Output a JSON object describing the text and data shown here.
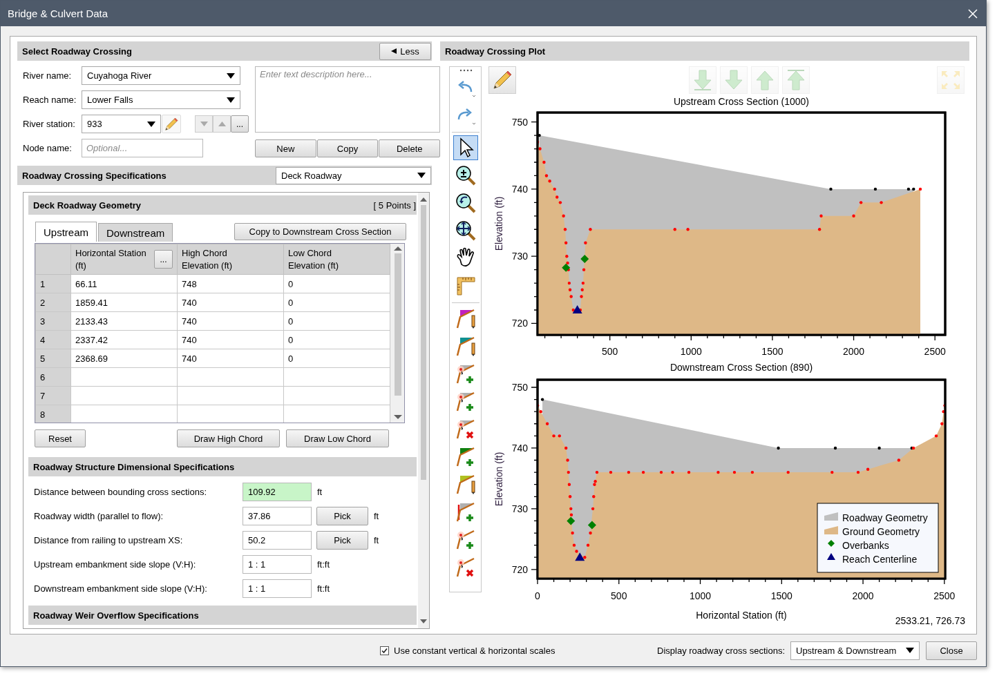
{
  "window": {
    "title": "Bridge & Culvert Data"
  },
  "select_section": {
    "title": "Select Roadway Crossing",
    "less_button": "Less",
    "river_name": {
      "label": "River name:",
      "value": "Cuyahoga River"
    },
    "reach_name": {
      "label": "Reach name:",
      "value": "Lower Falls"
    },
    "river_station": {
      "label": "River station:",
      "value": "933",
      "more_button": "..."
    },
    "node_name": {
      "label": "Node name:",
      "placeholder": "Optional..."
    },
    "description": {
      "placeholder": "Enter text description here..."
    },
    "buttons": [
      "New",
      "Copy",
      "Delete"
    ]
  },
  "specs": {
    "title": "Roadway Crossing Specifications",
    "type": "Deck Roadway"
  },
  "geometry": {
    "title": "Deck Roadway Geometry",
    "count": "[ 5 Points ]",
    "tabs": [
      {
        "label": "Upstream",
        "selected": true
      },
      {
        "label": "Downstream",
        "selected": false
      }
    ],
    "copy_button": "Copy to Downstream Cross Section",
    "columns": [
      "Horizontal Station (ft)",
      "High Chord Elevation (ft)",
      "Low Chord Elevation (ft)"
    ],
    "column_button": "...",
    "rows": [
      {
        "index": "1",
        "cells": [
          "66.11",
          "748",
          "0"
        ]
      },
      {
        "index": "2",
        "cells": [
          "1859.41",
          "740",
          "0"
        ]
      },
      {
        "index": "3",
        "cells": [
          "2133.43",
          "740",
          "0"
        ]
      },
      {
        "index": "4",
        "cells": [
          "2337.42",
          "740",
          "0"
        ]
      },
      {
        "index": "5",
        "cells": [
          "2368.69",
          "740",
          "0"
        ]
      },
      {
        "index": "6"
      },
      {
        "index": "7"
      },
      {
        "index": "8"
      }
    ],
    "reset_button": "Reset",
    "draw_buttons": [
      "Draw High Chord",
      "Draw Low Chord"
    ]
  },
  "dimensions": {
    "title": "Roadway Structure Dimensional Specifications",
    "fields": [
      {
        "label": "Distance between bounding cross sections:",
        "value": "109.92",
        "unit": "ft",
        "highlighted": true
      },
      {
        "label": "Roadway width (parallel to flow):",
        "value": "37.86",
        "pick": "Pick",
        "unit": "ft",
        "highlighted": false
      },
      {
        "label": "Distance from railing to upstream XS:",
        "value": "50.2",
        "pick": "Pick",
        "unit": "ft",
        "highlighted": false
      },
      {
        "label": "Upstream embankment side slope (V:H):",
        "value": "1 : 1",
        "unit": "ft:ft",
        "highlighted": false
      },
      {
        "label": "Downstream embankment side slope (V:H):",
        "value": "1 : 1",
        "unit": "ft:ft",
        "highlighted": false
      }
    ]
  },
  "weir": {
    "title": "Roadway Weir Overflow Specifications"
  },
  "plot": {
    "title": "Roadway Crossing Plot",
    "tools": [
      {
        "kind": "undo",
        "separator_before": false,
        "selected": false
      },
      {
        "kind": "redo",
        "separator_before": false,
        "selected": false
      },
      {
        "kind": "select",
        "separator_before": true,
        "selected": true
      },
      {
        "kind": "zoom",
        "separator_before": false,
        "selected": false
      },
      {
        "kind": "zoom-back",
        "separator_before": false,
        "selected": false
      },
      {
        "kind": "zoom-fit",
        "separator_before": false,
        "selected": false
      },
      {
        "kind": "pan",
        "separator_before": false,
        "selected": false
      },
      {
        "kind": "ruler",
        "separator_before": false,
        "selected": false
      },
      {
        "kind": "chord-magenta",
        "separator_before": true,
        "selected": false
      },
      {
        "kind": "chord-teal",
        "separator_before": false,
        "selected": false
      },
      {
        "kind": "point-add",
        "separator_before": false,
        "selected": false
      },
      {
        "kind": "point-add",
        "separator_before": false,
        "selected": false
      },
      {
        "kind": "point-delete",
        "separator_before": false,
        "selected": false
      },
      {
        "kind": "fill-add",
        "separator_before": false,
        "selected": false
      },
      {
        "kind": "fill-edit",
        "separator_before": false,
        "selected": false
      },
      {
        "kind": "wall-add",
        "separator_before": false,
        "selected": false
      },
      {
        "kind": "vertex-add",
        "separator_before": false,
        "selected": false
      },
      {
        "kind": "vertex-delete",
        "separator_before": false,
        "selected": false
      }
    ],
    "plot_buttons": [
      {
        "kind": "edit",
        "disabled": false
      },
      {
        "kind": "to-bottom",
        "disabled": true
      },
      {
        "kind": "down",
        "disabled": true
      },
      {
        "kind": "up",
        "disabled": true
      },
      {
        "kind": "to-top",
        "disabled": true
      },
      {
        "kind": "fit",
        "disabled": true
      }
    ],
    "charts": [
      {
        "chart_data": {
          "type": "area",
          "title": "Upstream Cross Section (1000)",
          "ylabel": "Elevation (ft)",
          "xlim": [
            55,
            2563
          ],
          "ylim": [
            718.3,
            751.4
          ],
          "xticks": [
            500,
            1000,
            1500,
            2000,
            2500
          ],
          "yticks": [
            720,
            730,
            740,
            750
          ],
          "series": [
            {
              "type": "area",
              "color": "#c0c0c0",
              "x": [
                66.11,
                1859.41,
                2133.43,
                2337.42,
                2368.69
              ],
              "values": [
                748,
                740,
                740,
                740,
                740
              ]
            },
            {
              "type": "area",
              "color": "#deb887",
              "x": [
                55,
                70,
                95,
                110,
                130,
                160,
                175,
                195,
                215,
                225,
                230,
                235,
                240,
                245,
                250,
                255,
                262,
                275,
                300,
                318,
                325,
                330,
                335,
                340,
                350,
                380,
                900,
                980,
                1790,
                1800,
                2000,
                2045,
                2170,
                2410
              ],
              "values": [
                747,
                746,
                744,
                742,
                741.2,
                740,
                738.8,
                738,
                736,
                734,
                732,
                730,
                729,
                728,
                726,
                725,
                724,
                722,
                722,
                722,
                724,
                725,
                726,
                728,
                732,
                734,
                734,
                734,
                734,
                736,
                736,
                738,
                738,
                740
              ]
            },
            {
              "type": "scatter",
              "color": "#008000",
              "x": [
                230,
                345
              ],
              "values": [
                728.3,
                729.6
              ]
            },
            {
              "type": "scatter",
              "color": "#000080",
              "x": [
                300
              ],
              "values": [
                722
              ]
            }
          ]
        }
      },
      {
        "chart_data": {
          "type": "area",
          "legend": "lower right",
          "title": "Downstream Cross Section (890)",
          "xlabel": "Horizontal Station (ft)",
          "ylabel": "Elevation (ft)",
          "xlim": [
            0,
            2505
          ],
          "ylim": [
            718.5,
            751.25
          ],
          "xticks": [
            0,
            500,
            1000,
            1500,
            2000,
            2500
          ],
          "yticks": [
            720,
            730,
            740,
            750
          ],
          "series": [
            {
              "name": "Roadway Geometry",
              "type": "area",
              "color": "#c0c0c0",
              "x": [
                30,
                1480,
                1830,
                2100,
                2300
              ],
              "values": [
                748,
                740,
                740,
                740,
                740
              ]
            },
            {
              "name": "Ground Geometry",
              "type": "area",
              "color": "#deb887",
              "x": [
                0,
                20,
                60,
                100,
                135,
                175,
                185,
                190,
                195,
                200,
                205,
                208,
                215,
                225,
                240,
                290,
                310,
                325,
                330,
                340,
                345,
                350,
                355,
                365,
                450,
                560,
                650,
                760,
                830,
                930,
                1110,
                1210,
                1320,
                1540,
                1810,
                1970,
                2030,
                2220,
                2310,
                2450,
                2485,
                2495,
                2503
              ],
              "values": [
                747,
                746,
                744,
                742,
                742,
                740,
                738,
                736,
                734,
                732,
                730,
                729,
                726,
                724,
                723,
                722,
                724,
                726,
                727.5,
                730,
                732,
                734,
                734.5,
                736,
                736,
                736,
                736,
                736,
                736,
                736,
                736,
                736,
                736,
                736,
                736,
                736,
                736.5,
                738,
                740,
                742,
                744,
                746,
                747
              ]
            },
            {
              "name": "Overbanks",
              "type": "scatter",
              "color": "#008000",
              "x": [
                205,
                335
              ],
              "values": [
                728,
                727.3
              ]
            },
            {
              "name": "Reach Centerline",
              "type": "scatter",
              "color": "#000080",
              "x": [
                260
              ],
              "values": [
                722
              ]
            }
          ]
        }
      }
    ],
    "cursor_readout": "2533.21, 726.73"
  },
  "footer": {
    "constant_scales": {
      "label": "Use constant vertical & horizontal scales",
      "checked": true
    },
    "display": {
      "label": "Display roadway cross sections:",
      "value": "Upstream & Downstream"
    },
    "close_button": "Close"
  }
}
